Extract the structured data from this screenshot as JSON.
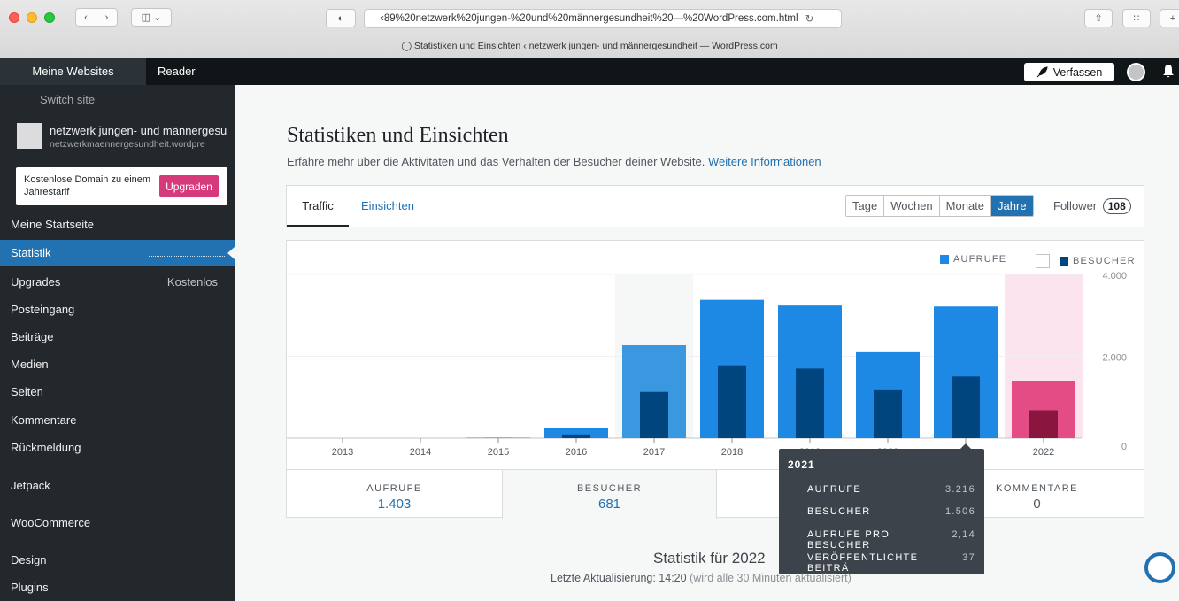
{
  "browser": {
    "url": "‹89%20netzwerk%20jungen-%20und%20männergesundheit%20—%20WordPress.com.html",
    "title": "Statistiken und Einsichten ‹ netzwerk jungen- und männergesundheit — WordPress.com"
  },
  "adminbar": {
    "my_sites": "Meine Websites",
    "reader": "Reader",
    "write": "Verfassen"
  },
  "sidebar": {
    "switch_site": "Switch site",
    "site_name": "netzwerk jungen- und männergesu",
    "site_url": "netzwerkmaennergesundheit.wordpre",
    "promo_text": "Kostenlose Domain zu einem Jahrestarif",
    "promo_button": "Upgraden",
    "items": [
      {
        "label": "Meine Startseite"
      },
      {
        "label": "Statistik"
      },
      {
        "label": "Upgrades",
        "badge": "Kostenlos"
      },
      {
        "label": "Posteingang"
      },
      {
        "label": "Beiträge"
      },
      {
        "label": "Medien"
      },
      {
        "label": "Seiten"
      },
      {
        "label": "Kommentare"
      },
      {
        "label": "Rückmeldung"
      },
      {
        "label": "Jetpack"
      },
      {
        "label": "WooCommerce"
      },
      {
        "label": "Design"
      },
      {
        "label": "Plugins"
      }
    ]
  },
  "main": {
    "title": "Statistiken und Einsichten",
    "subtitle": "Erfahre mehr über die Aktivitäten und das Verhalten der Besucher deiner Website.",
    "more_link": "Weitere Informationen",
    "tabs": {
      "traffic": "Traffic",
      "insights": "Einsichten"
    },
    "periods": [
      "Tage",
      "Wochen",
      "Monate",
      "Jahre"
    ],
    "follower_label": "Follower",
    "follower_count": "108"
  },
  "legend": {
    "views": "AUFRUFE",
    "visitors": "BESUCHER"
  },
  "chart_data": {
    "type": "bar",
    "categories": [
      "2013",
      "2014",
      "2015",
      "2016",
      "2017",
      "2018",
      "2019",
      "2020",
      "2021",
      "2022"
    ],
    "series": [
      {
        "name": "AUFRUFE",
        "values": [
          0,
          0,
          10,
          260,
          2270,
          3380,
          3240,
          2100,
          3216,
          1403
        ]
      },
      {
        "name": "BESUCHER",
        "values": [
          0,
          0,
          5,
          90,
          1130,
          1780,
          1700,
          1170,
          1506,
          681
        ]
      }
    ],
    "yticks": [
      "0",
      "2.000",
      "4.000"
    ],
    "ylim": [
      0,
      4000
    ],
    "colors": {
      "views": "#1e88e5",
      "visitors": "#01457f",
      "views_current": "#e34c84",
      "visitors_current": "#8a1640"
    }
  },
  "stats": [
    {
      "label": "AUFRUFE",
      "value": "1.403"
    },
    {
      "label": "BESUCHER",
      "value": "681"
    },
    {
      "label": "KOMMENTARE",
      "value": "0"
    }
  ],
  "tooltip": {
    "title": "2021",
    "rows": [
      {
        "label": "AUFRUFE",
        "value": "3.216"
      },
      {
        "label": "BESUCHER",
        "value": "1.506"
      },
      {
        "label": "AUFRUFE PRO BESUCHER",
        "value": "2,14"
      },
      {
        "label": "VERÖFFENTLICHTE BEITRÄ",
        "value": "37"
      }
    ]
  },
  "footer": {
    "title": "Statistik für 2022",
    "updated": "Letzte Aktualisierung: 14:20",
    "updated_note": "(wird alle 30 Minuten aktualisiert)"
  }
}
